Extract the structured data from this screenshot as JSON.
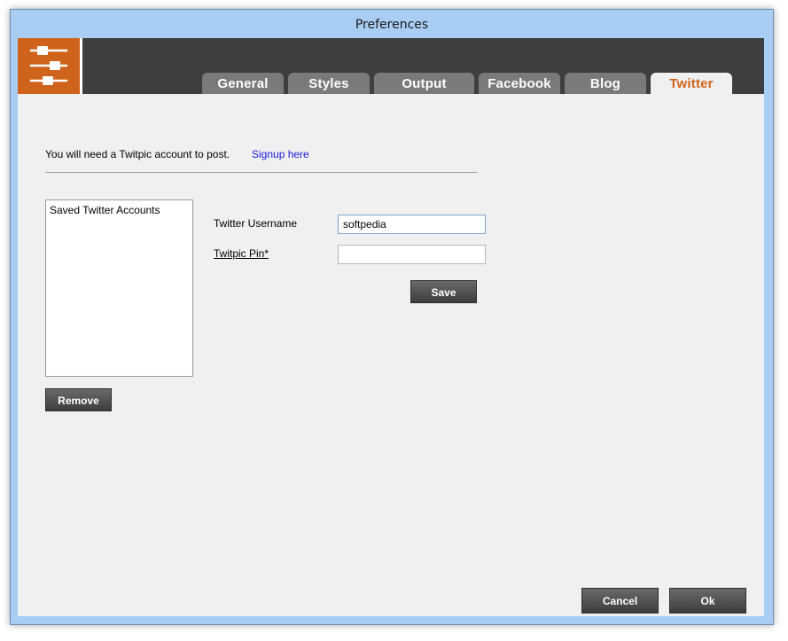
{
  "window": {
    "title": "Preferences"
  },
  "tabs": [
    {
      "label": "General"
    },
    {
      "label": "Styles"
    },
    {
      "label": "Output"
    },
    {
      "label": "Facebook"
    },
    {
      "label": "Blog"
    },
    {
      "label": "Twitter",
      "active": true
    }
  ],
  "twitter": {
    "notice": "You will need a Twitpic account to post.",
    "signup_link": "Signup here",
    "accounts_header": "Saved Twitter Accounts",
    "username_label": "Twitter Username",
    "username_value": "softpedia",
    "pin_label": "Twitpic Pin*",
    "pin_value": "",
    "save_label": "Save",
    "remove_label": "Remove"
  },
  "footer": {
    "cancel_label": "Cancel",
    "ok_label": "Ok"
  },
  "colors": {
    "accent": "#d0631b",
    "header_bg": "#3e3e3e",
    "tab_bg": "#7a7a7a",
    "link": "#1a1adf"
  }
}
